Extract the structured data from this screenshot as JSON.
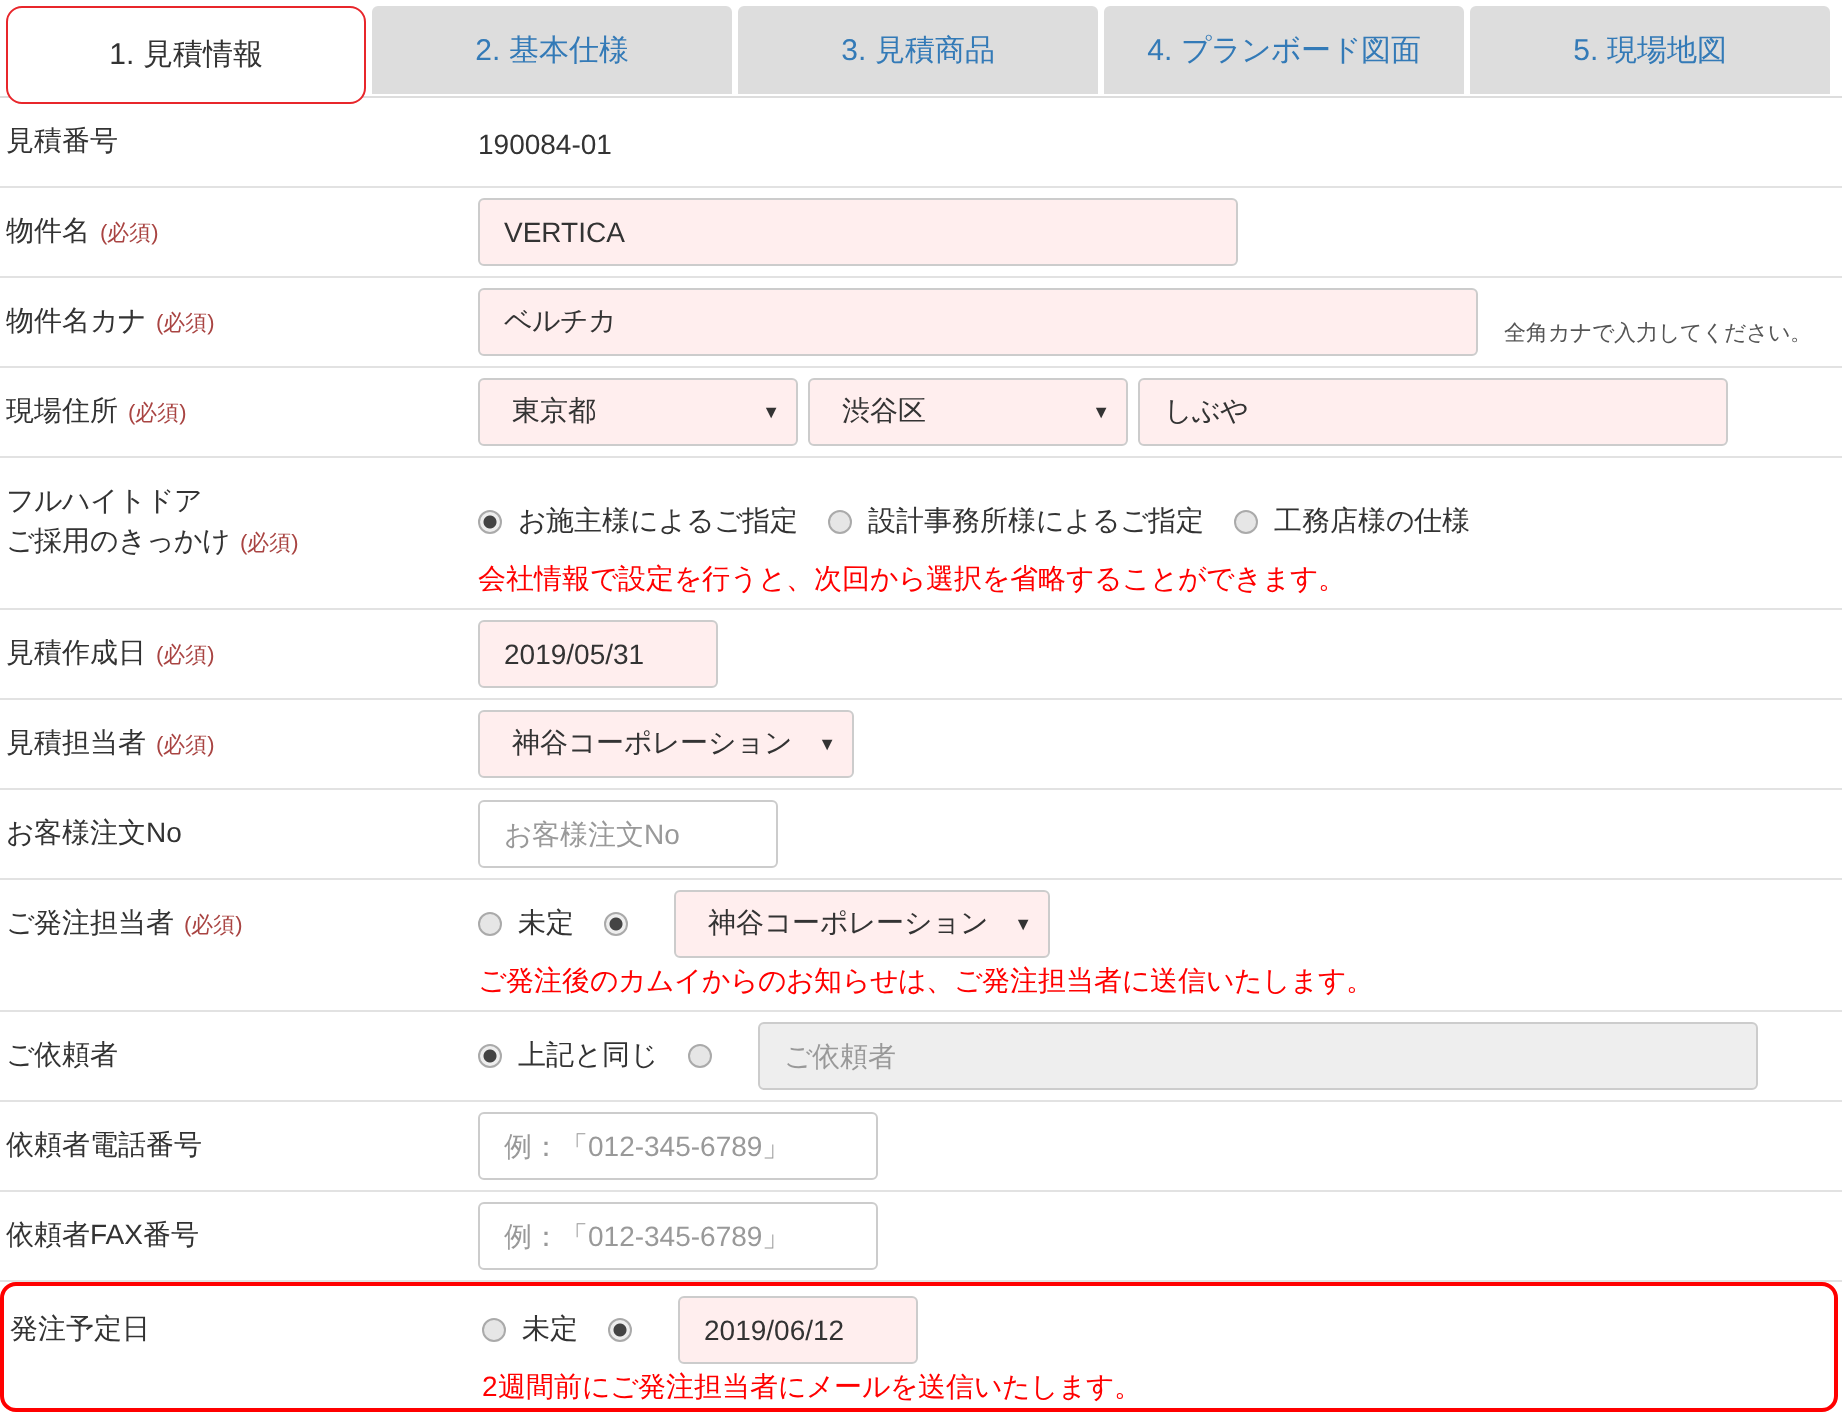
{
  "tabs": [
    {
      "label": "1. 見積情報",
      "selected": true
    },
    {
      "label": "2. 基本仕様",
      "selected": false
    },
    {
      "label": "3. 見積商品",
      "selected": false
    },
    {
      "label": "4. プランボード図面",
      "selected": false
    },
    {
      "label": "5. 現場地図",
      "selected": false
    }
  ],
  "rows": [
    {
      "label_lines": [
        "見積番号"
      ],
      "highlighted": false,
      "controls": [
        {
          "kind": "static",
          "text": "190084-01"
        }
      ]
    },
    {
      "label_lines": [
        "物件名"
      ],
      "required": "(必須)",
      "highlighted": false,
      "controls": [
        {
          "kind": "input",
          "value": "VERTICA",
          "required": true
        }
      ]
    },
    {
      "label_lines": [
        "物件名カナ"
      ],
      "required": "(必須)",
      "highlighted": false,
      "controls": [
        {
          "kind": "input",
          "value": "ベルチカ",
          "required": true
        },
        {
          "kind": "note",
          "text": "全角カナで入力してください。"
        }
      ]
    },
    {
      "label_lines": [
        "現場住所"
      ],
      "required": "(必須)",
      "highlighted": false,
      "controls": [
        {
          "kind": "select",
          "value": "東京都",
          "caret": "▼",
          "required": true
        },
        {
          "kind": "select",
          "value": "渋谷区",
          "caret": "▼",
          "required": true
        },
        {
          "kind": "input",
          "value": "しぶや",
          "required": true
        }
      ]
    },
    {
      "label_lines": [
        "フルハイトドア",
        "ご採用のきっかけ"
      ],
      "required": "(必須)",
      "highlighted": false,
      "controls": [
        {
          "kind": "radio",
          "label": "お施主様によるご指定",
          "selected": true
        },
        {
          "kind": "radio",
          "label": "設計事務所様によるご指定",
          "selected": false
        },
        {
          "kind": "radio",
          "label": "工務店様の仕様",
          "selected": false
        }
      ],
      "message": "会社情報で設定を行うと、次回から選択を省略することができます。"
    },
    {
      "label_lines": [
        "見積作成日"
      ],
      "required": "(必須)",
      "highlighted": false,
      "controls": [
        {
          "kind": "input",
          "value": "2019/05/31",
          "required": true
        }
      ]
    },
    {
      "label_lines": [
        "見積担当者"
      ],
      "required": "(必須)",
      "highlighted": false,
      "controls": [
        {
          "kind": "select",
          "value": "神谷コーポレーション",
          "caret": "▼",
          "required": true
        }
      ]
    },
    {
      "label_lines": [
        "お客様注文No"
      ],
      "highlighted": false,
      "controls": [
        {
          "kind": "input",
          "placeholder": "お客様注文No",
          "required": false
        }
      ]
    },
    {
      "label_lines": [
        "ご発注担当者"
      ],
      "required": "(必須)",
      "highlighted": false,
      "controls": [
        {
          "kind": "radio",
          "label": "未定",
          "selected": false
        },
        {
          "kind": "radio",
          "selected": true
        },
        {
          "kind": "select",
          "value": "神谷コーポレーション",
          "caret": "▼",
          "required": true
        }
      ],
      "message": "ご発注後のカムイからのお知らせは、ご発注担当者に送信いたします。"
    },
    {
      "label_lines": [
        "ご依頼者"
      ],
      "highlighted": false,
      "controls": [
        {
          "kind": "radio",
          "label": "上記と同じ",
          "selected": true
        },
        {
          "kind": "radio",
          "selected": false
        },
        {
          "kind": "input",
          "placeholder": "ご依頼者",
          "disabled": true
        }
      ]
    },
    {
      "label_lines": [
        "依頼者電話番号"
      ],
      "highlighted": false,
      "controls": [
        {
          "kind": "input",
          "placeholder": "例：「012-345-6789」",
          "required": false
        }
      ]
    },
    {
      "label_lines": [
        "依頼者FAX番号"
      ],
      "highlighted": false,
      "controls": [
        {
          "kind": "input",
          "placeholder": "例：「012-345-6789」",
          "required": false
        }
      ]
    },
    {
      "label_lines": [
        "発注予定日"
      ],
      "highlighted": true,
      "controls": [
        {
          "kind": "radio",
          "label": "未定",
          "selected": false
        },
        {
          "kind": "radio",
          "selected": true
        },
        {
          "kind": "input",
          "value": "2019/06/12",
          "required": true
        }
      ],
      "message": "2週間前にご発注担当者にメールを送信いたします。"
    }
  ]
}
